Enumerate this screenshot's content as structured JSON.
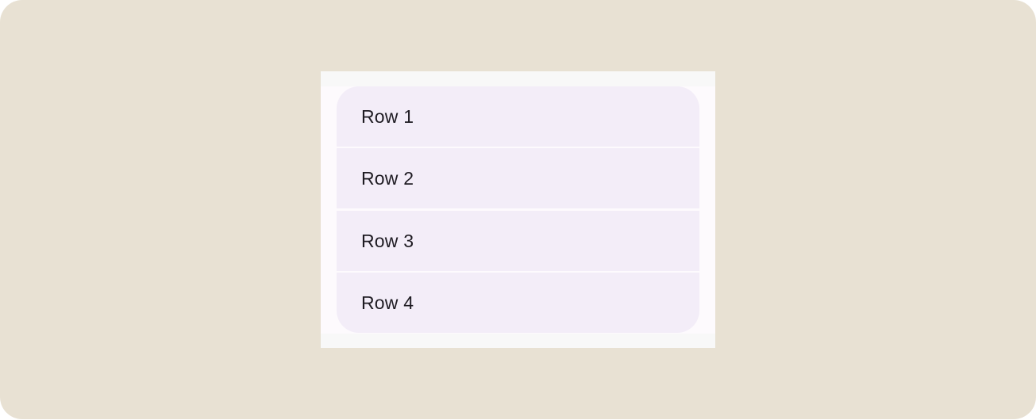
{
  "list": {
    "items": [
      {
        "label": "Row 1"
      },
      {
        "label": "Row 2"
      },
      {
        "label": "Row 3"
      },
      {
        "label": "Row 4"
      }
    ]
  },
  "colors": {
    "background": "#e8e1d3",
    "surface": "#fdfafd",
    "row_container": "#f3edf8",
    "text": "#1e1b22"
  }
}
